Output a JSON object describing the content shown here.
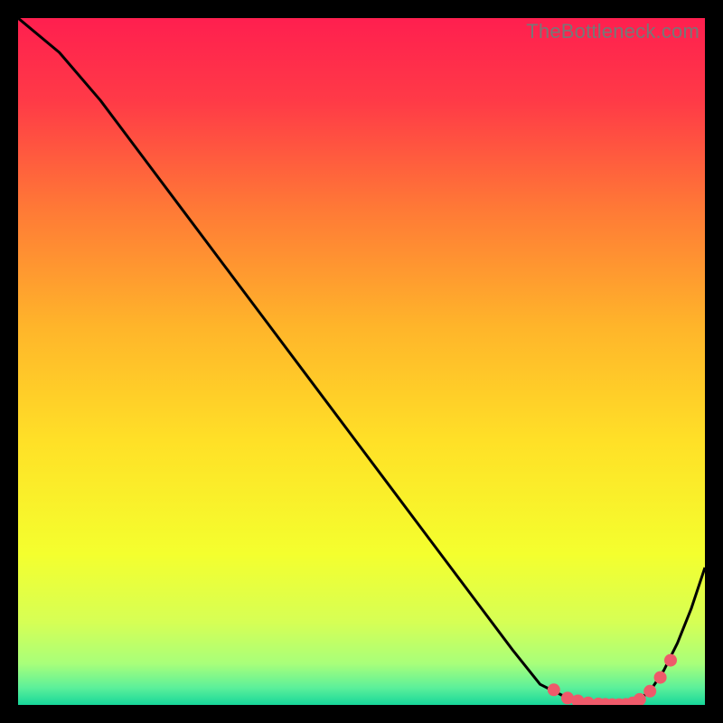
{
  "watermark": "TheBottleneck.com",
  "chart_data": {
    "type": "line",
    "title": "",
    "xlabel": "",
    "ylabel": "",
    "xlim": [
      0,
      100
    ],
    "ylim": [
      0,
      100
    ],
    "grid": false,
    "legend": false,
    "background": {
      "type": "vertical-gradient",
      "stops": [
        {
          "pos": 0.0,
          "color": "#ff1f4f"
        },
        {
          "pos": 0.12,
          "color": "#ff3a47"
        },
        {
          "pos": 0.28,
          "color": "#ff7a36"
        },
        {
          "pos": 0.45,
          "color": "#ffb52a"
        },
        {
          "pos": 0.62,
          "color": "#ffe127"
        },
        {
          "pos": 0.78,
          "color": "#f4ff2e"
        },
        {
          "pos": 0.88,
          "color": "#d6ff55"
        },
        {
          "pos": 0.94,
          "color": "#a8ff7a"
        },
        {
          "pos": 0.975,
          "color": "#5cf09a"
        },
        {
          "pos": 1.0,
          "color": "#17d79a"
        }
      ]
    },
    "series": [
      {
        "name": "bottleneck-curve",
        "color": "#000000",
        "stroke_width": 3,
        "x": [
          0,
          6,
          12,
          18,
          24,
          30,
          36,
          42,
          48,
          54,
          60,
          66,
          72,
          76,
          80,
          82,
          84,
          86,
          88,
          90,
          92,
          94,
          96,
          98,
          100
        ],
        "y": [
          100,
          95,
          88,
          80,
          72,
          64,
          56,
          48,
          40,
          32,
          24,
          16,
          8,
          3,
          1,
          0.5,
          0.1,
          0,
          0,
          0.5,
          2,
          5,
          9,
          14,
          20
        ]
      }
    ],
    "points": {
      "name": "highlighted-points",
      "marker_color": "#ef5a6a",
      "marker_radius": 7,
      "x": [
        78,
        80,
        81.5,
        83,
        84.5,
        85.5,
        86.5,
        87.5,
        88.5,
        89.5,
        90.5,
        92,
        93.5,
        95
      ],
      "y": [
        2.2,
        1.0,
        0.6,
        0.3,
        0.15,
        0.08,
        0.05,
        0.05,
        0.08,
        0.3,
        0.8,
        2.0,
        4.0,
        6.5
      ]
    }
  }
}
